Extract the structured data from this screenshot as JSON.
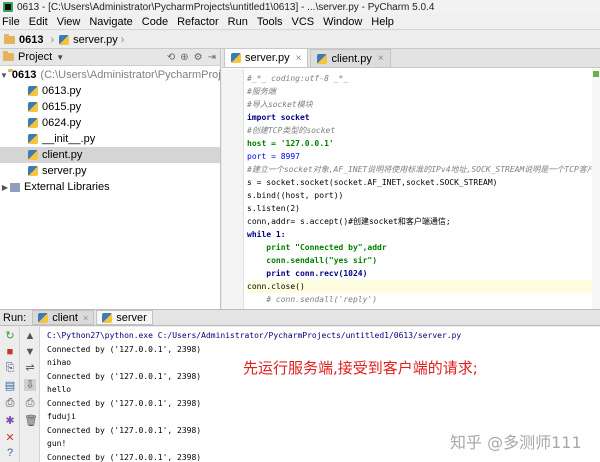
{
  "window": {
    "title": "0613 - [C:\\Users\\Administrator\\PycharmProjects\\untitled1\\0613] - ...\\server.py - PyCharm 5.0.4"
  },
  "menu": [
    "File",
    "Edit",
    "View",
    "Navigate",
    "Code",
    "Refactor",
    "Run",
    "Tools",
    "VCS",
    "Window",
    "Help"
  ],
  "breadcrumb": {
    "project": "0613",
    "file": "server.py"
  },
  "project_panel": {
    "title": "Project",
    "root": {
      "name": "0613",
      "path": "(C:\\Users\\Administrator\\PycharmProjects\\u"
    },
    "files": [
      "0613.py",
      "0615.py",
      "0624.py",
      "__init__.py",
      "client.py",
      "server.py"
    ],
    "selected": "client.py",
    "external": "External Libraries"
  },
  "editor_tabs": [
    "server.py",
    "client.py"
  ],
  "code": [
    "#_*_ coding:utf-8 _*_",
    "#服务端",
    "#导入socket模块",
    "import socket",
    "#创建TCP类型的socket",
    "host = '127.0.0.1'",
    "port = 8997",
    "#建立一个socket对象,AF_INET说明将使用标准的IPv4地址,SOCK_STREAM说明是一个TCP客户端",
    "s = socket.socket(socket.AF_INET,socket.SOCK_STREAM)",
    "s.bind((host, port))",
    "s.listen(2)",
    "conn,addr= s.accept()#创建socket和客户端通信;",
    "while 1:",
    "    print \"Connected by\",addr",
    "    conn.sendall(\"yes sir\")",
    "    print conn.recv(1024)",
    "conn.close()",
    "    # conn.sendall('reply')"
  ],
  "run": {
    "label": "Run:",
    "tabs": [
      "client",
      "server"
    ],
    "console": [
      "C:\\Python27\\python.exe C:/Users/Administrator/PycharmProjects/untitled1/0613/server.py",
      "Connected by ('127.0.0.1', 2398)",
      "nihao",
      "Connected by ('127.0.0.1', 2398)",
      "hello",
      "Connected by ('127.0.0.1', 2398)",
      "fuduji",
      "Connected by ('127.0.0.1', 2398)",
      "gun!",
      "Connected by ('127.0.0.1', 2398)"
    ]
  },
  "annotation": "先运行服务端,接受到客户端的请求;",
  "watermark": "知乎 @多测师111"
}
